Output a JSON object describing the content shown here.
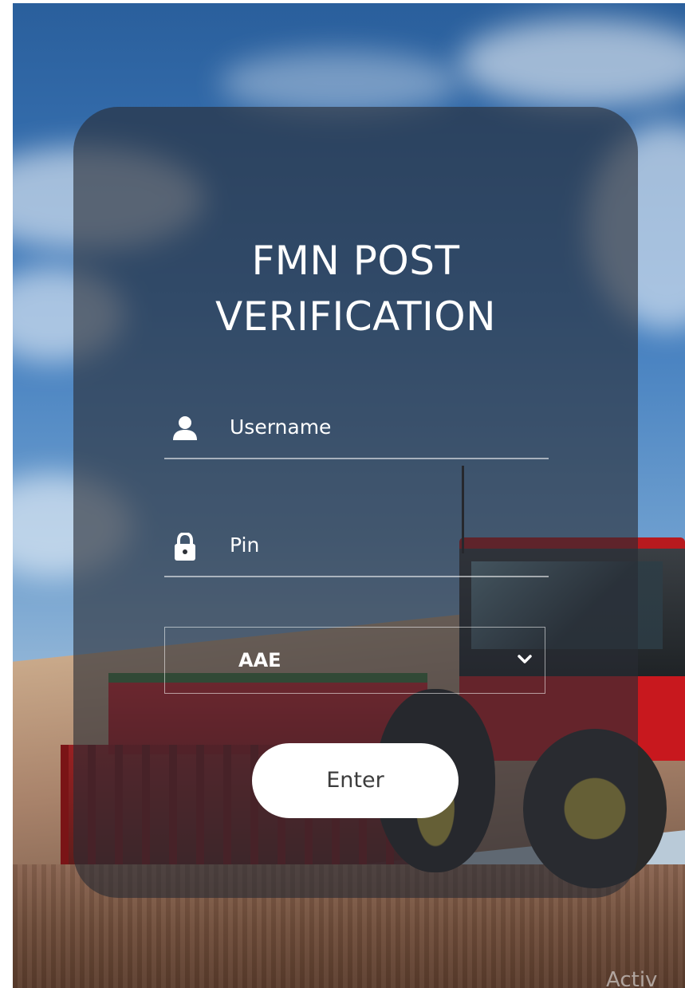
{
  "login": {
    "title_line1": "FMN POST",
    "title_line2": "VERIFICATION",
    "username_placeholder": "Username",
    "pin_placeholder": "Pin",
    "selected_option": "AAE",
    "enter_label": "Enter"
  },
  "icons": {
    "user": "user-icon",
    "lock": "lock-icon",
    "dropdown": "chevron-down-icon"
  },
  "watermark": "Activ",
  "colors": {
    "card_overlay": "#282c34",
    "text": "#ffffff",
    "button_bg": "#ffffff",
    "button_text": "#3c3c3c"
  }
}
